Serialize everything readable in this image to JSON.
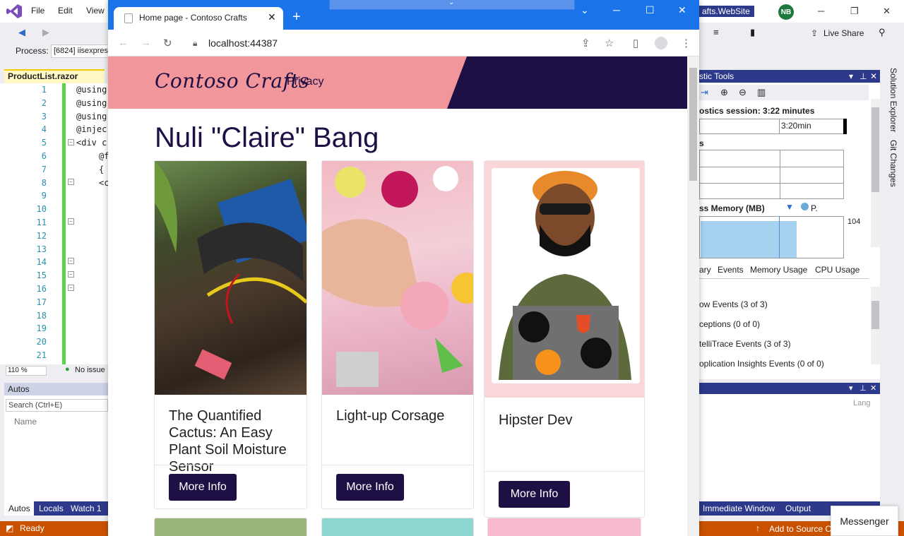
{
  "vs": {
    "menu": {
      "file": "File",
      "edit": "Edit",
      "view": "View"
    },
    "title_fragment": "afts.WebSite",
    "avatar_initials": "NB",
    "live_share": "Live Share",
    "process_label": "Process:",
    "process_value": "[6824] iisexpres",
    "editor_tab": "ProductList.razor",
    "line_numbers": [
      "1",
      "2",
      "3",
      "4",
      "5",
      "6",
      "7",
      "8",
      "9",
      "10",
      "11",
      "12",
      "13",
      "14",
      "15",
      "16",
      "17",
      "18",
      "19",
      "20",
      "21"
    ],
    "code_lines": [
      "@using",
      "@using",
      "@using",
      "@injec",
      "<div c",
      "@f",
      "{",
      "<c"
    ],
    "zoom": "110 %",
    "issues": "No issue",
    "autos_title": "Autos",
    "autos_search": "Search (Ctrl+E)",
    "autos_col_name": "Name",
    "bottom_tabs": {
      "autos": "Autos",
      "locals": "Locals",
      "watch": "Watch 1"
    },
    "status_ready": "Ready",
    "status_right": "Add to Source C",
    "status_color": "#ca5100"
  },
  "diag": {
    "title": "stic Tools",
    "session": "ostics session: 3:22 minutes",
    "time_label": "3:20min",
    "events_label": "s",
    "memory_label": "ss Memory (MB)",
    "memory_legend": "P.",
    "memory_value": "104",
    "tabs": {
      "summary": "ary",
      "events": "Events",
      "memory": "Memory Usage",
      "cpu": "CPU Usage"
    },
    "events": [
      "ow Events (3 of 3)",
      "ceptions (0 of 0)",
      "telliTrace Events (3 of 3)",
      "oplication Insights Events (0 of 0)"
    ],
    "side_tabs": {
      "solution": "Solution Explorer",
      "git": "Git Changes"
    },
    "imm_lang": "Lang",
    "imm_tabs": {
      "immediate": "Immediate Window",
      "output": "Output"
    },
    "messenger": "Messenger"
  },
  "browser": {
    "tab_title": "Home page - Contoso Crafts",
    "url": "localhost:44387"
  },
  "site": {
    "brand": "Contoso Crafts",
    "nav_privacy": "Privacy",
    "heading": "Nuli \"Claire\" Bang",
    "cards": [
      {
        "title": "The Quantified Cactus: An Easy Plant Soil Moisture Sensor",
        "button": "More Info"
      },
      {
        "title": "Light-up Corsage",
        "button": "More Info"
      },
      {
        "title": "Hipster Dev",
        "button": "More Info"
      }
    ],
    "colors": {
      "header_pink": "#f1969a",
      "header_dark": "#1e0f44",
      "button": "#1e0f44"
    }
  }
}
